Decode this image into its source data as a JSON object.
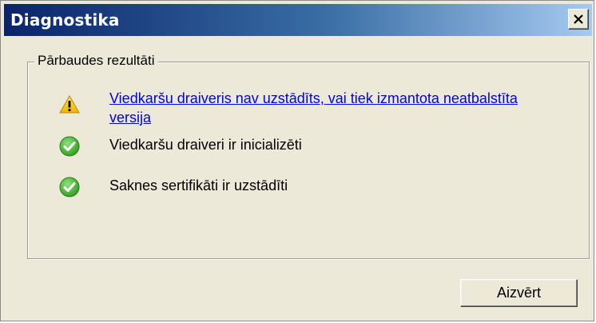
{
  "window": {
    "title": "Diagnostika",
    "close_glyph": "close-icon"
  },
  "results": {
    "group_label": "Pārbaudes rezultāti",
    "items": [
      {
        "status": "warning",
        "icon": "warning-icon",
        "text": "Viedkaršu draiveris nav uzstādīts, vai tiek izmantota neatbalstīta versija",
        "is_link": true
      },
      {
        "status": "ok",
        "icon": "check-icon",
        "text": "Viedkaršu draiveri ir inicializēti",
        "is_link": false
      },
      {
        "status": "ok",
        "icon": "check-icon",
        "text": "Saknes sertifikāti ir uzstādīti",
        "is_link": false
      }
    ]
  },
  "buttons": {
    "close_label": "Aizvērt"
  },
  "colors": {
    "title_gradient_start": "#0a246a",
    "title_gradient_end": "#a6caf0",
    "dialog_background": "#ece9d8",
    "link": "#0000ee",
    "warning": "#f5c400",
    "ok": "#3cb521"
  }
}
